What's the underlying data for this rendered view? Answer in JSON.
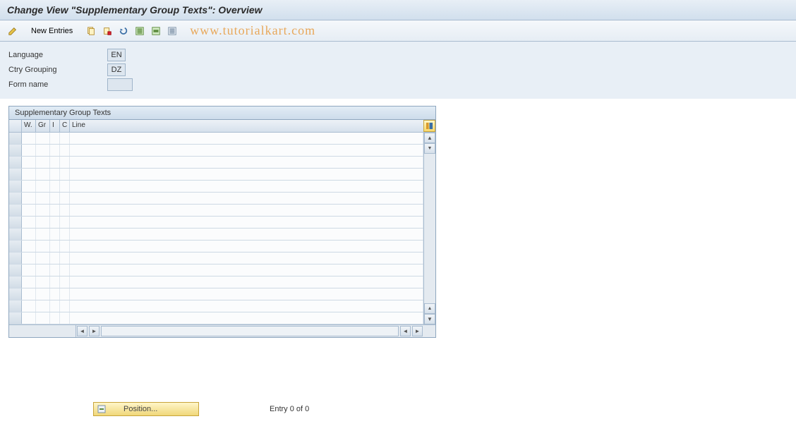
{
  "page_title": "Change View \"Supplementary Group Texts\": Overview",
  "toolbar": {
    "new_entries_label": "New Entries"
  },
  "watermark": "www.tutorialkart.com",
  "form": {
    "language_label": "Language",
    "language_value": "EN",
    "ctry_grouping_label": "Ctry Grouping",
    "ctry_grouping_value": "DZ",
    "form_name_label": "Form name",
    "form_name_value": ""
  },
  "table": {
    "title": "Supplementary Group Texts",
    "columns": [
      "W.",
      "Gr",
      "I",
      "C",
      "Line"
    ],
    "row_count": 16
  },
  "footer": {
    "position_label": "Position...",
    "entry_text": "Entry 0 of 0"
  }
}
